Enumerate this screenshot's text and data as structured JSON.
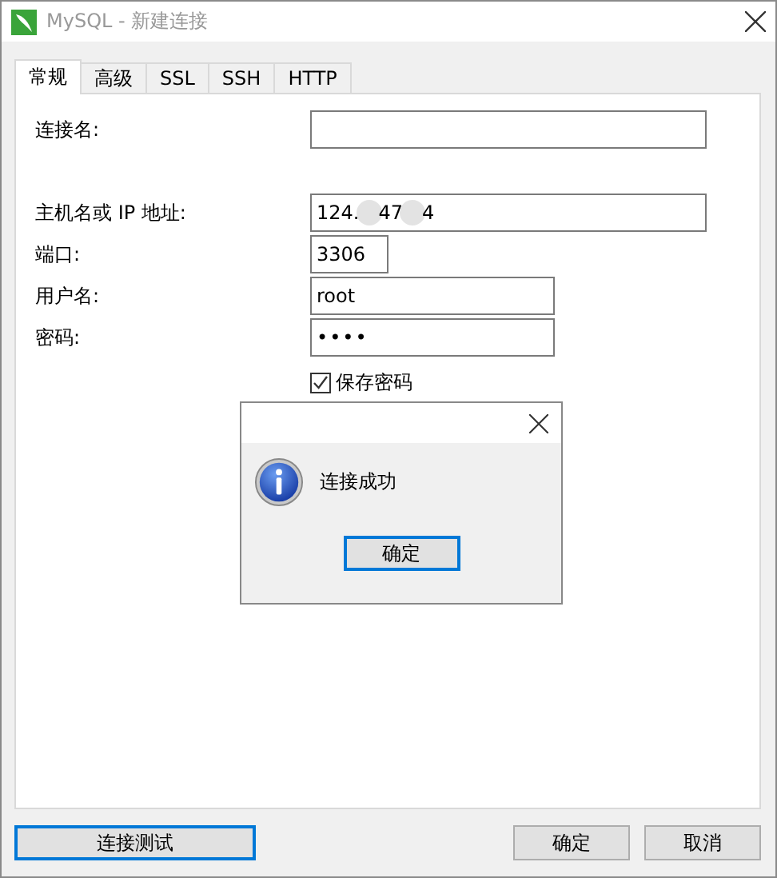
{
  "window": {
    "title": "MySQL - 新建连接"
  },
  "tabs": [
    {
      "label": "常规",
      "selected": true
    },
    {
      "label": "高级",
      "selected": false
    },
    {
      "label": "SSL",
      "selected": false
    },
    {
      "label": "SSH",
      "selected": false
    },
    {
      "label": "HTTP",
      "selected": false
    }
  ],
  "fields": [
    {
      "kind": "name",
      "label": "连接名:"
    },
    {
      "kind": "host",
      "label": "主机名或 IP 地址:",
      "value_parts": [
        "124.",
        "47",
        "4"
      ]
    },
    {
      "kind": "port",
      "label": "端口:",
      "value": "3306"
    },
    {
      "kind": "user",
      "label": "用户名:",
      "value": "root"
    },
    {
      "kind": "password",
      "label": "密码:",
      "value": "••••"
    }
  ],
  "save_password": {
    "label": "保存密码",
    "checked": true
  },
  "message_box": {
    "message": "连接成功",
    "button": "确定"
  },
  "buttons": {
    "test": "连接测试",
    "ok": "确定",
    "cancel": "取消"
  }
}
